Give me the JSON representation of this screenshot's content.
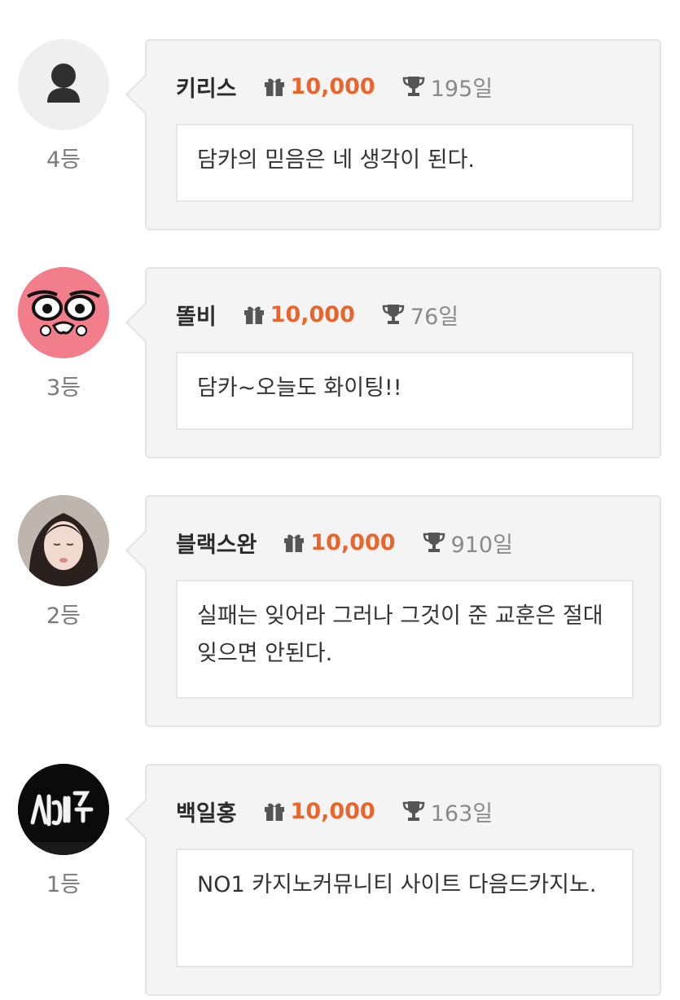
{
  "entries": [
    {
      "rank": "4등",
      "name": "키리스",
      "amount": "10,000",
      "days": "195일",
      "message": "담카의 믿음은 네 생각이 된다.",
      "avatar": "default-user-avatar"
    },
    {
      "rank": "3등",
      "name": "똘비",
      "amount": "10,000",
      "days": "76일",
      "message": "담카~오늘도 화이팅!!",
      "avatar": "pink-cartoon-face-avatar"
    },
    {
      "rank": "2등",
      "name": "블랙스완",
      "amount": "10,000",
      "days": "910일",
      "message": "실패는 잊어라 그러나 그것이 준 교훈은 절대 잊으면 안된다.",
      "avatar": "woman-photo-avatar"
    },
    {
      "rank": "1등",
      "name": "백일홍",
      "amount": "10,000",
      "days": "163일",
      "message": "NO1 카지노커뮤니티 사이트 다음드카지노.",
      "avatar": "neon-sign-photo-avatar"
    }
  ],
  "icons": {
    "gift": "gift-icon",
    "trophy": "trophy-icon"
  },
  "colors": {
    "amount": "#e8662d",
    "card_bg": "#f4f4f4",
    "card_border": "#e4e4e4"
  }
}
